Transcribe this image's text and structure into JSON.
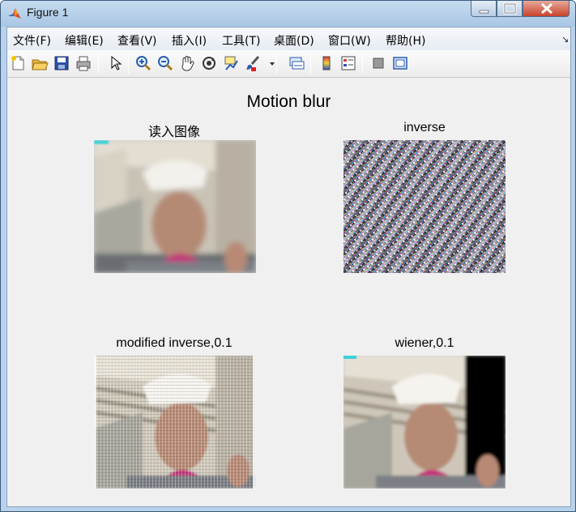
{
  "window": {
    "title": "Figure 1",
    "icon": "matlab-logo-icon",
    "controls": [
      "minimize-icon",
      "maximize-icon",
      "close-icon"
    ]
  },
  "menu": {
    "items": [
      "文件(F)",
      "编辑(E)",
      "查看(V)",
      "插入(I)",
      "工具(T)",
      "桌面(D)",
      "窗口(W)",
      "帮助(H)"
    ],
    "overflow_glyph": "↘"
  },
  "toolbar": {
    "buttons": [
      "new-figure-icon",
      "open-file-icon",
      "save-icon",
      "print-icon",
      "pointer-icon",
      "zoom-in-icon",
      "zoom-out-icon",
      "pan-hand-icon",
      "rotate-3d-icon",
      "data-cursor-icon",
      "brush-icon",
      "brush-dropdown-icon",
      "link-plot-icon",
      "colorbar-icon",
      "legend-icon",
      "hide-plot-tools-icon",
      "show-plot-tools-icon"
    ]
  },
  "figure": {
    "suptitle": "Motion blur",
    "axes": [
      {
        "title": "读入图像",
        "image": "blurred-face-photo"
      },
      {
        "title": "inverse",
        "image": "noise-pattern"
      },
      {
        "title": "modified inverse,0.1",
        "image": "restored-face-photo-with-ringing"
      },
      {
        "title": "wiener,0.1",
        "image": "restored-face-photo"
      }
    ]
  },
  "colors": {
    "titlebar": "#b9d1ea",
    "figure_background": "#f0f0f0",
    "close_button": "#c7432a"
  }
}
